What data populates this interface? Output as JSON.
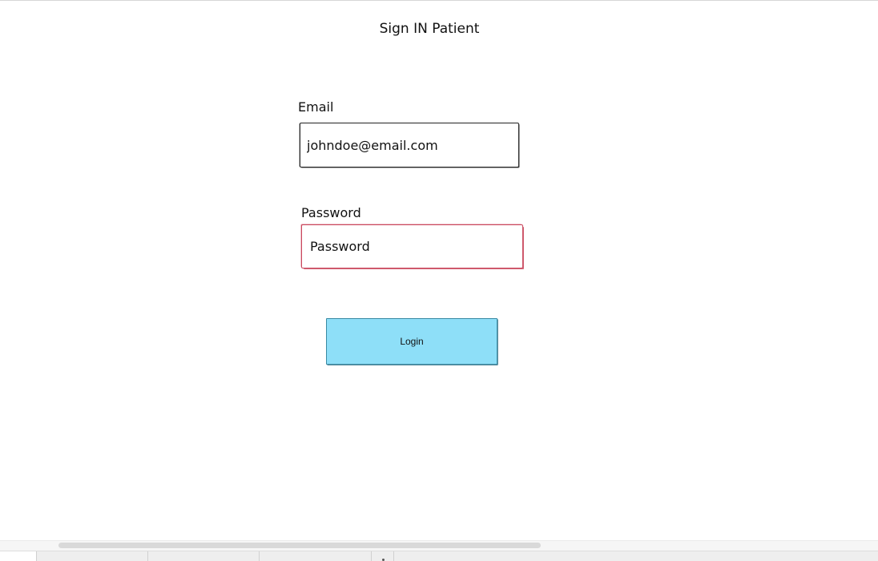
{
  "page": {
    "title": "Sign IN Patient"
  },
  "form": {
    "email_label": "Email",
    "email_value": "johndoe@email.com",
    "password_label": "Password",
    "password_placeholder": "Password",
    "login_label": "Login"
  }
}
